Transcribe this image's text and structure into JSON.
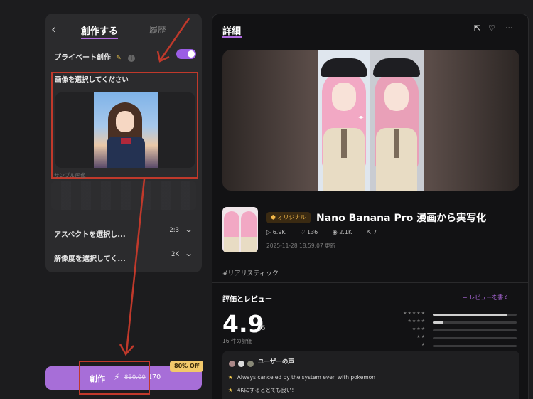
{
  "left_panel": {
    "back_icon": "chevron-left-icon",
    "tab_create": "創作する",
    "tab_history": "履歴",
    "private_label": "プライベート創作",
    "private_enabled": true,
    "select_image_title": "画像を選択してください",
    "sample_caption": "サンプル画像",
    "aspect_label": "アスペクトを選択し...",
    "aspect_value": "2:3",
    "resolution_label": "解像度を選択してく...",
    "resolution_value": "2K"
  },
  "create_button": {
    "label": "創作",
    "old_price": "850.00",
    "new_price": "170",
    "discount": "80% Off"
  },
  "detail": {
    "title": "詳細",
    "badge": "オリジナル",
    "model_title": "Nano Banana Pro 漫画から実写化",
    "stats": {
      "runs": "6.9K",
      "likes": "136",
      "views": "2.1K",
      "shares": "7"
    },
    "date": "2025-11-28 18:59:07 更新",
    "tag": "#リアリスティック"
  },
  "reviews": {
    "title": "評価とレビュー",
    "write_label": "+ レビューを書く",
    "rating": "4.9",
    "rating_max": "/5",
    "count_text": "16 件の評価",
    "bars": [
      {
        "stars": "★★★★★",
        "fraction": 0.88
      },
      {
        "stars": "★★★★",
        "fraction": 0.12
      },
      {
        "stars": "★★★",
        "fraction": 0.0
      },
      {
        "stars": "★★",
        "fraction": 0.0
      },
      {
        "stars": "★",
        "fraction": 0.0
      }
    ],
    "voice_title": "ユーザーの声",
    "voices": [
      "Always canceled by the system even with pokemon",
      "4Kにするととても良い!"
    ]
  },
  "colors": {
    "accent": "#b06ae0",
    "button": "#a76ed8",
    "badge": "#f2c96b",
    "annotation": "#c0392b"
  }
}
